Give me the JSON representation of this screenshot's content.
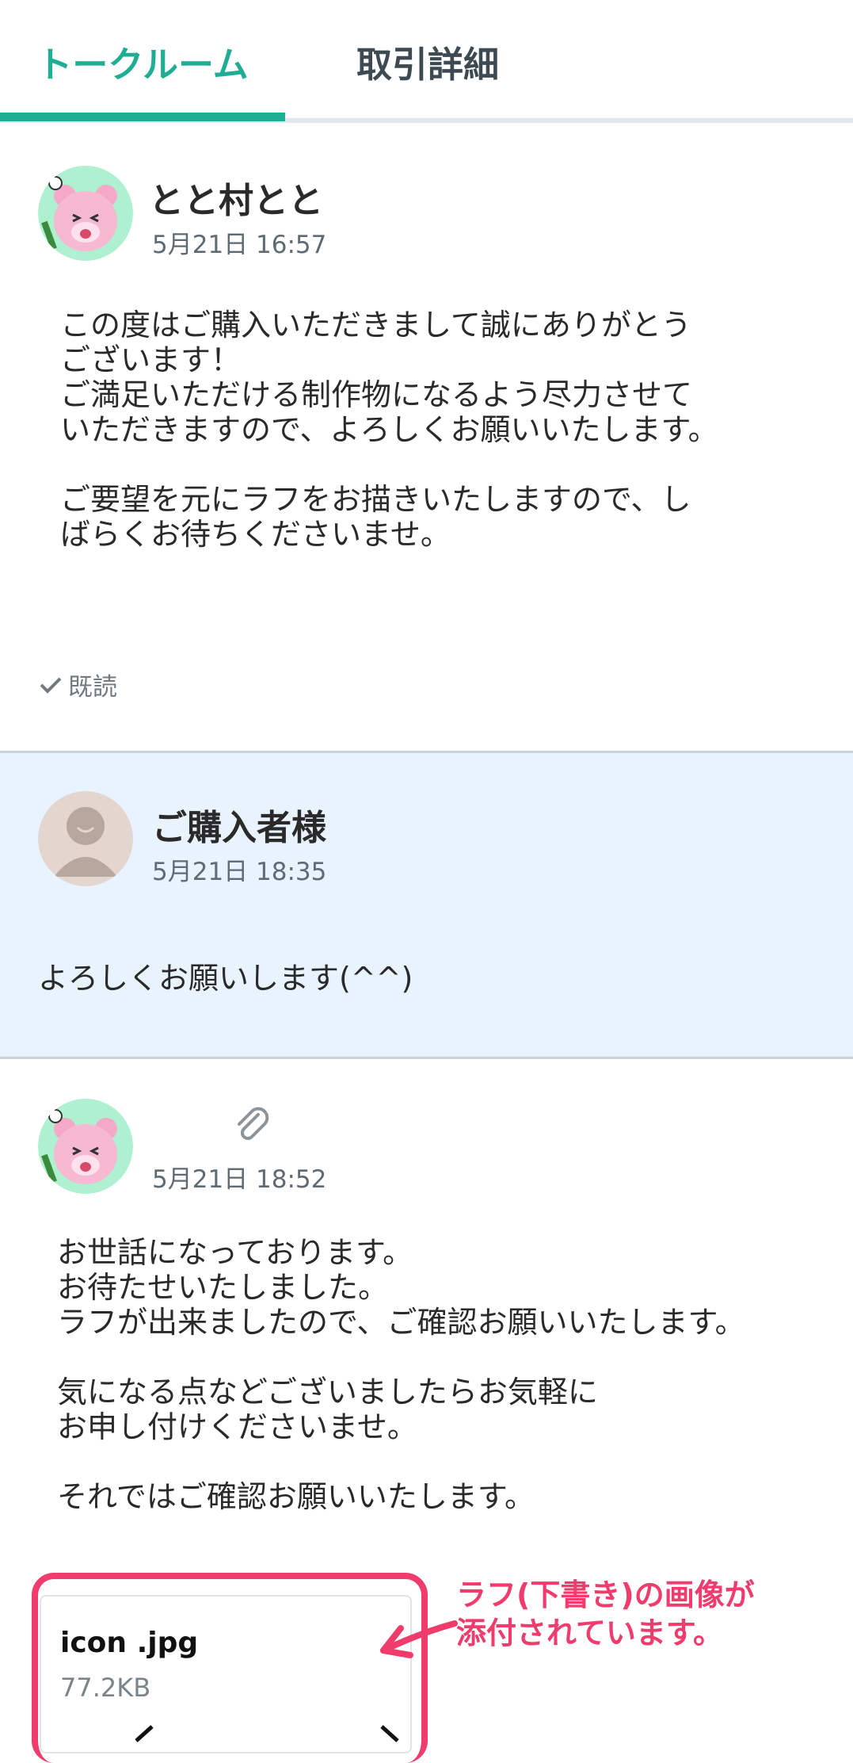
{
  "tabs": [
    {
      "label": "トークルーム",
      "active": true
    },
    {
      "label": "取引詳細",
      "active": false
    }
  ],
  "colors": {
    "accent": "#1fae93",
    "buyer_bg": "#e9f3fd",
    "annotation": "#ef3c6d"
  },
  "messages": [
    {
      "sender": "とと村とと",
      "time": "5月21日 16:57",
      "avatar_icon": "pink-bear-avatar-icon",
      "body": "この度はご購入いただきまして誠にありがとう\nございます！\nご満足いただける制作物になるよう尽力させて\nいただきますので、よろしくお願いいたします。\n\nご要望を元にラフをお描きいたしますので、し\nばらくお待ちくださいませ。",
      "read_label": "既読"
    },
    {
      "sender": "ご購入者様",
      "time": "5月21日 18:35",
      "avatar_icon": "default-user-avatar-icon",
      "body": "よろしくお願いします(^^)"
    },
    {
      "sender": "",
      "time": "5月21日 18:52",
      "avatar_icon": "pink-bear-avatar-icon",
      "attachment_indicator": "paperclip-icon",
      "body": "お世話になっております。\nお待たせいたしました。\nラフが出来ましたので、ご確認お願いいたします。\n\n気になる点などございましたらお気軽に\nお申し付けくださいませ。\n\nそれではご確認お願いいたします。",
      "attachment": {
        "file_name": "icon .jpg",
        "file_size": "77.2KB"
      }
    }
  ],
  "annotation": {
    "text": "ラフ(下書き)の画像が\n添付されています。"
  }
}
